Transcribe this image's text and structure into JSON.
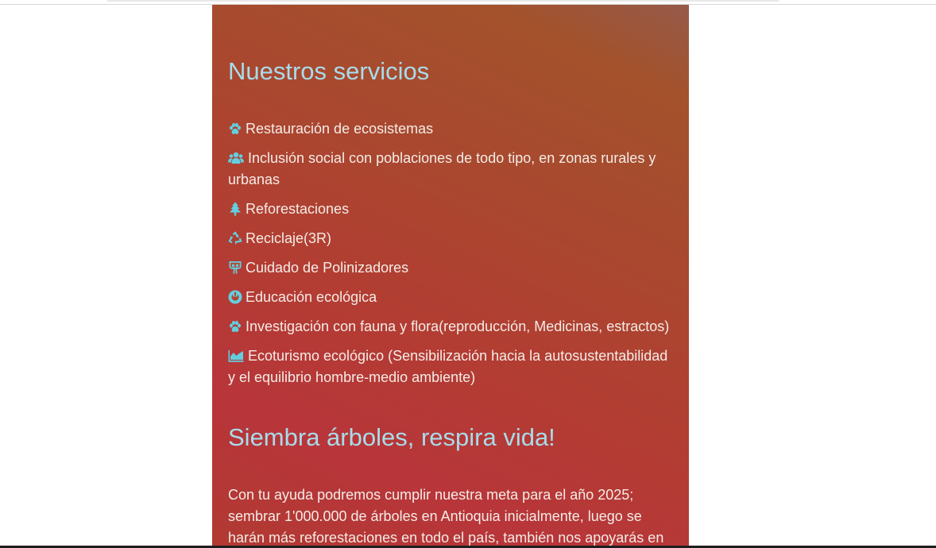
{
  "section_services": {
    "title": "Nuestros servicios",
    "items": [
      {
        "icon": "paw-icon",
        "label": "Restauración de ecosistemas"
      },
      {
        "icon": "users-icon",
        "label": "Inclusión social con poblaciones de todo tipo, en zonas rurales y urbanas"
      },
      {
        "icon": "tree-icon",
        "label": "Reforestaciones"
      },
      {
        "icon": "recycle-icon",
        "label": "Reciclaje(3R)"
      },
      {
        "icon": "slideshare-icon",
        "label": "Cuidado de Polinizadores"
      },
      {
        "icon": "rebel-icon",
        "label": "Educación ecológica"
      },
      {
        "icon": "paw-icon",
        "label": "Investigación con fauna y flora(reproducción, Medicinas, estractos)"
      },
      {
        "icon": "area-chart-icon",
        "label": "Ecoturismo ecológico (Sensibilización hacia la autosustentabilidad y el equilibrio hombre-medio ambiente)"
      }
    ]
  },
  "section_plant": {
    "title": "Siembra árboles, respira vida!",
    "paragraph": "Con tu ayuda podremos cumplir nuestra meta para el año 2025; sembrar 1'000.000 de árboles en Antioquia inicialmente, luego se harán más reforestaciones en todo el país, también nos apoyarás en"
  },
  "colors": {
    "heading": "#a8dcea",
    "icon": "#62cfe0",
    "text": "#f4ece6",
    "panel_top": "#a3522c",
    "panel_bottom": "#b8353a"
  }
}
